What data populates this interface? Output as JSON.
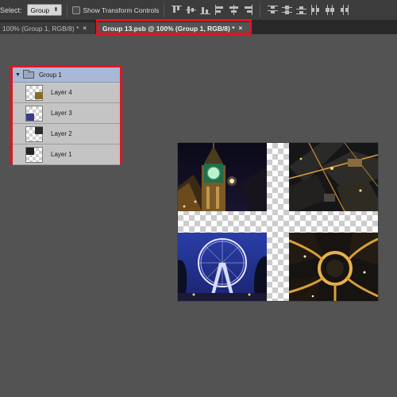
{
  "options_bar": {
    "select_label": "Select:",
    "select_value": "Group",
    "show_transform_label": "Show Transform Controls",
    "align_icons": [
      "align-top-icon",
      "align-vcenter-icon",
      "align-bottom-icon",
      "align-left-icon",
      "align-hcenter-icon",
      "align-right-icon"
    ],
    "distribute_icons": [
      "distribute-top-icon",
      "distribute-vcenter-icon",
      "distribute-bottom-icon",
      "distribute-left-icon",
      "distribute-hcenter-icon",
      "distribute-right-icon"
    ]
  },
  "tabs": [
    {
      "label": "100% (Group 1, RGB/8) *",
      "close": "×",
      "active": false
    },
    {
      "label": "Group 13.psb @ 100% (Group 1, RGB/8) *",
      "close": "×",
      "active": true
    }
  ],
  "layers": {
    "group": {
      "name": "Group 1",
      "expanded": true,
      "icon": "folder-icon"
    },
    "items": [
      {
        "name": "Layer 4"
      },
      {
        "name": "Layer 3"
      },
      {
        "name": "Layer 2"
      },
      {
        "name": "Layer 1"
      }
    ]
  },
  "colors": {
    "highlight": "#e1151f",
    "workspace": "#535353",
    "group_row": "#a9b8d6"
  }
}
